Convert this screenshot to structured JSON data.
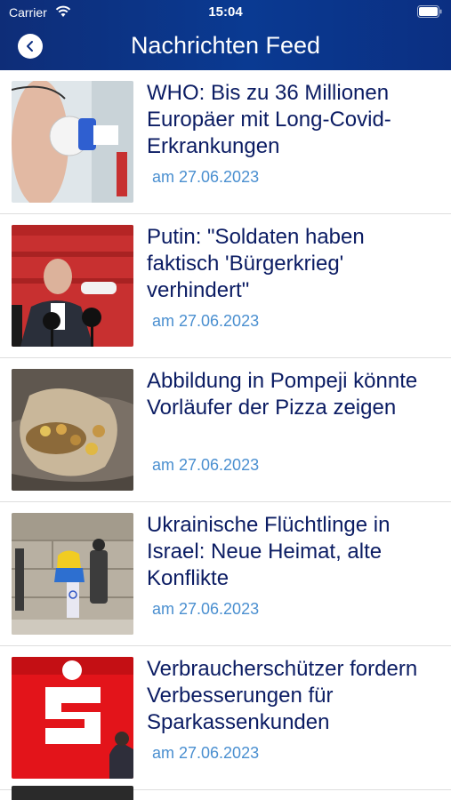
{
  "status_bar": {
    "carrier": "Carrier",
    "time": "15:04"
  },
  "header": {
    "title": "Nachrichten Feed"
  },
  "feed": [
    {
      "headline": "WHO: Bis zu 36 Millionen Europäer mit Long-Covid-Erkrankungen",
      "date": "am 27.06.2023"
    },
    {
      "headline": "Putin: \"Soldaten haben faktisch 'Bürgerkrieg' verhindert\"",
      "date": "am 27.06.2023"
    },
    {
      "headline": "Abbildung in Pompeji könnte Vorläufer der Pizza zeigen",
      "date": "am 27.06.2023"
    },
    {
      "headline": "Ukrainische Flüchtlinge in Israel: Neue Heimat, alte Konflikte",
      "date": "am 27.06.2023"
    },
    {
      "headline": "Verbraucherschützer fordern Verbesserungen für Sparkassenkunden",
      "date": "am 27.06.2023"
    }
  ]
}
